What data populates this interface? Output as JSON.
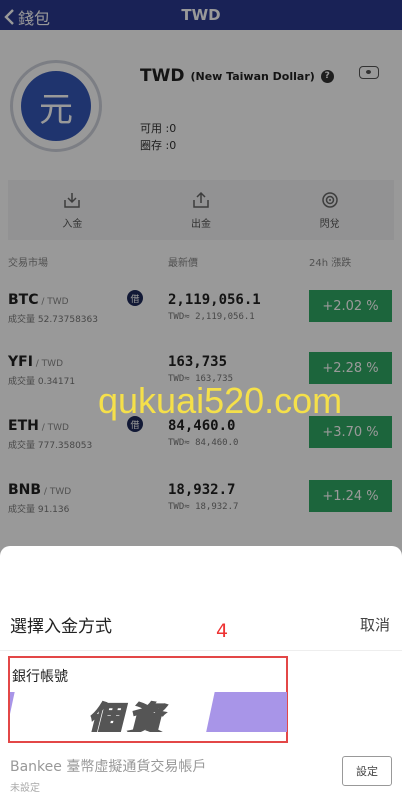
{
  "header": {
    "back_label": "錢包",
    "title": "TWD"
  },
  "currency": {
    "icon_char": "元",
    "code": "TWD",
    "full_name": "(New Taiwan Dollar)",
    "help_char": "?",
    "available": "可用 :0",
    "frozen": "圈存 :0"
  },
  "actions": [
    {
      "label": "入金",
      "icon": "deposit-icon"
    },
    {
      "label": "出金",
      "icon": "withdraw-icon"
    },
    {
      "label": "閃兌",
      "icon": "exchange-icon"
    }
  ],
  "market_header": {
    "col1": "交易市場",
    "col2": "最新價",
    "col3": "24h 漲跌"
  },
  "market": [
    {
      "symbol": "BTC",
      "pair": " / TWD",
      "volume": "成交量 52.73758363",
      "badge": "借",
      "price": "2,119,056.1",
      "twd": "TWD≈ 2,119,056.1",
      "change": "+2.02 %"
    },
    {
      "symbol": "YFI",
      "pair": " / TWD",
      "volume": "成交量 0.34171",
      "badge": "",
      "price": "163,735",
      "twd": "TWD≈ 163,735",
      "change": "+2.28 %"
    },
    {
      "symbol": "ETH",
      "pair": " / TWD",
      "volume": "成交量 777.358053",
      "badge": "借",
      "price": "84,460.0",
      "twd": "TWD≈ 84,460.0",
      "change": "+3.70 %"
    },
    {
      "symbol": "BNB",
      "pair": " / TWD",
      "volume": "成交量 91.136",
      "badge": "",
      "price": "18,932.7",
      "twd": "TWD≈ 18,932.7",
      "change": "+1.24 %"
    }
  ],
  "watermark": "qukuai520.com",
  "sheet": {
    "title": "選擇入金方式",
    "cancel": "取消",
    "step": "4",
    "bank_label": "銀行帳號",
    "censor_text": "個資",
    "account_label": "Bankee 臺幣虛擬通貨交易帳戶",
    "account_status": "未設定",
    "set_button": "設定"
  },
  "colors": {
    "header": "#2b3a8f",
    "up": "#2fa864",
    "highlight": "#e34747",
    "watermark": "#f5e04a"
  }
}
